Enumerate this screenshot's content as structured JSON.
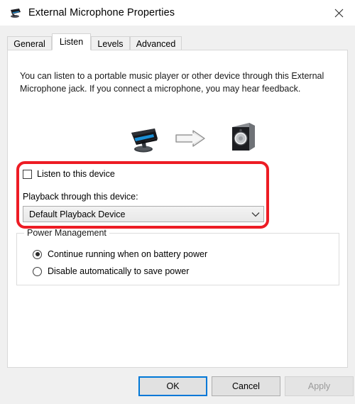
{
  "window": {
    "title": "External Microphone Properties",
    "icon": "microphone-device-icon",
    "close_label": "✕"
  },
  "tabs": [
    {
      "label": "General",
      "active": false
    },
    {
      "label": "Listen",
      "active": true
    },
    {
      "label": "Levels",
      "active": false
    },
    {
      "label": "Advanced",
      "active": false
    }
  ],
  "panel": {
    "description": "You can listen to a portable music player or other device through this External Microphone jack.  If you connect a microphone, you may hear feedback.",
    "illustration": {
      "source_icon": "microphone-icon",
      "arrow_icon": "right-arrow-icon",
      "destination_icon": "speaker-icon"
    },
    "listen": {
      "checkbox_label": "Listen to this device",
      "checked": false,
      "playback_label": "Playback through this device:",
      "playback_value": "Default Playback Device",
      "playback_options": [
        "Default Playback Device"
      ],
      "chevron_icon": "chevron-down-icon"
    },
    "power_management": {
      "legend": "Power Management",
      "options": [
        {
          "label": "Continue running when on battery power",
          "selected": true
        },
        {
          "label": "Disable automatically to save power",
          "selected": false
        }
      ]
    }
  },
  "buttons": {
    "ok": "OK",
    "cancel": "Cancel",
    "apply": "Apply",
    "apply_disabled": true
  },
  "annotation": {
    "type": "red-rounded-rectangle-highlight",
    "color": "#ed1c24"
  },
  "colors": {
    "dialog_background": "#f0f0f0",
    "panel_background": "#ffffff",
    "accent_focus": "#0078d7",
    "highlight": "#ed1c24",
    "border": "#d3d3d3"
  }
}
